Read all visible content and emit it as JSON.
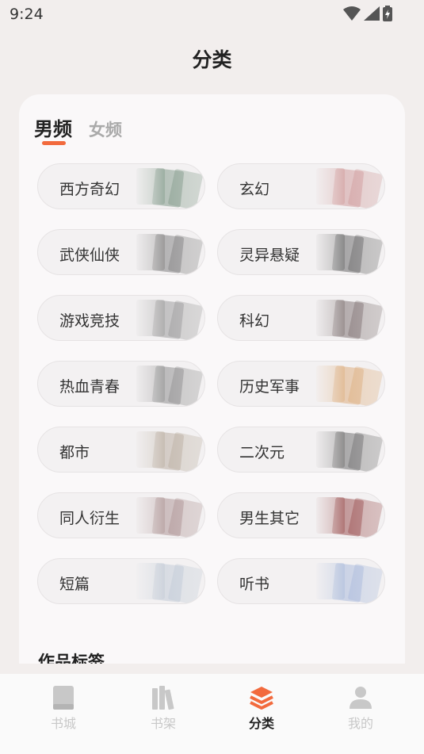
{
  "status_bar": {
    "time": "9:24"
  },
  "header": {
    "title": "分类"
  },
  "tabs": [
    {
      "label": "男频",
      "active": true
    },
    {
      "label": "女频",
      "active": false
    }
  ],
  "categories": [
    {
      "label": "西方奇幻",
      "tint": "#6d8a76"
    },
    {
      "label": "玄幻",
      "tint": "#c98a8a"
    },
    {
      "label": "武侠仙侠",
      "tint": "#6b6b6b"
    },
    {
      "label": "灵异悬疑",
      "tint": "#4d4d4d"
    },
    {
      "label": "游戏竞技",
      "tint": "#8a8a8a"
    },
    {
      "label": "科幻",
      "tint": "#6b5b5b"
    },
    {
      "label": "热血青春",
      "tint": "#7a7a7a"
    },
    {
      "label": "历史军事",
      "tint": "#d9a066"
    },
    {
      "label": "都市",
      "tint": "#b0a090"
    },
    {
      "label": "二次元",
      "tint": "#555555"
    },
    {
      "label": "同人衍生",
      "tint": "#a08080"
    },
    {
      "label": "男生其它",
      "tint": "#8a3030"
    },
    {
      "label": "短篇",
      "tint": "#b8c4d0"
    },
    {
      "label": "听书",
      "tint": "#9bb0d8"
    }
  ],
  "section_title": "作品标签",
  "bottom_nav": [
    {
      "label": "书城",
      "icon": "book-icon",
      "active": false
    },
    {
      "label": "书架",
      "icon": "bookshelf-icon",
      "active": false
    },
    {
      "label": "分类",
      "icon": "layers-icon",
      "active": true
    },
    {
      "label": "我的",
      "icon": "person-icon",
      "active": false
    }
  ],
  "colors": {
    "accent": "#f26a3d",
    "inactive": "#c8c8c8"
  }
}
